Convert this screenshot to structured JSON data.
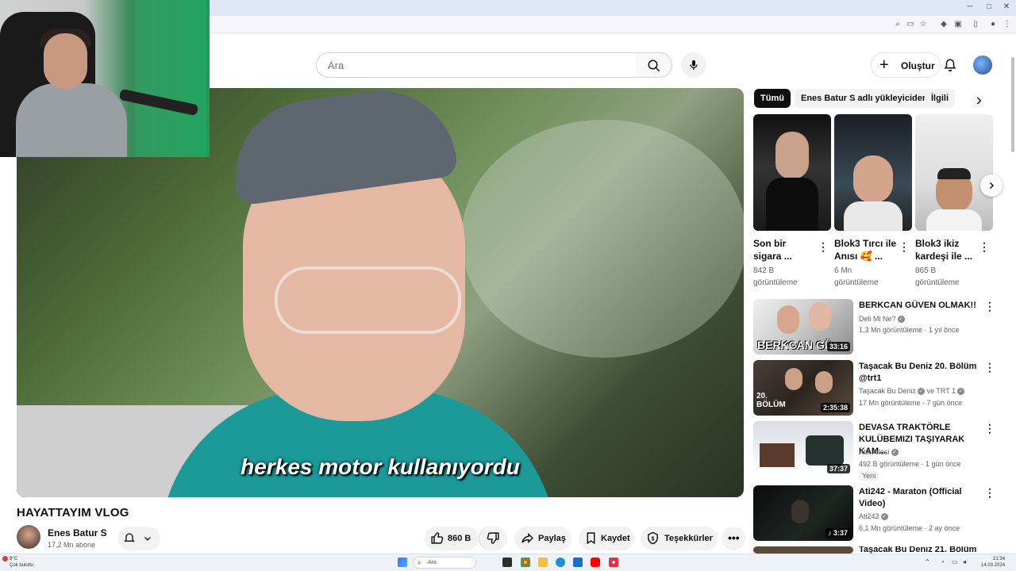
{
  "search": {
    "placeholder": "Ara"
  },
  "header": {
    "create_label": "Oluştur"
  },
  "video": {
    "title": "HAYATTAYIM VLOG",
    "subtitle": "herkes motor kullanıyordu",
    "channel_name": "Enes Batur S",
    "subscribers": "17,2 Mn abone",
    "likes": "860 B",
    "share_label": "Paylaş",
    "save_label": "Kaydet",
    "thanks_label": "Teşekkürler"
  },
  "chips": [
    "Tümü",
    "Enes Batur S adlı yükleyiciden",
    "İlgili"
  ],
  "shorts": [
    {
      "title": "Son bir sigara ...",
      "views": "842 B görüntüleme"
    },
    {
      "title": "Blok3 Tırcı ile Anısı 🥰 ...",
      "views": "6 Mn görüntüleme"
    },
    {
      "title": "Blok3 ikiz kardeşi ile ...",
      "views": "865 B görüntüleme"
    }
  ],
  "related": [
    {
      "title": "BERKCAN GÜVEN OLMAK!!",
      "channel": "Deli Mi Ne?",
      "meta": "1,3 Mn görüntüleme · 1 yıl önce",
      "duration": "33:16",
      "thumb_text": "BERKCAN GÜ"
    },
    {
      "title": "Taşacak Bu Deniz 20. Bölüm @trt1",
      "channel": "Taşacak Bu Deniz",
      "channel2": "ve TRT 1",
      "meta": "17 Mn görüntüleme · 7 gün önce",
      "duration": "2:35:38",
      "thumb_text": "20. BÖLÜM"
    },
    {
      "title": "DEVASA TRAKTÖRLE KULÜBEMIZI TAŞIYARAK KAM...",
      "channel": "Atik Ailesi",
      "meta": "492 B görüntüleme · 1 gün önce",
      "badge": "Yeni",
      "duration": "37:37"
    },
    {
      "title": "Ati242 - Maraton (Official Video)",
      "channel": "Ati242",
      "meta": "6,1 Mn görüntüleme · 2 ay önce",
      "duration": "♪ 3:37"
    },
    {
      "title": "Taşacak Bu Deniz 21. Bölüm"
    }
  ],
  "taskbar": {
    "weather_temp": "8°C",
    "weather_desc": "Çok bulutlu",
    "search_placeholder": "Ara",
    "time": "21:34",
    "date": "14.03.2024"
  },
  "colors": {
    "accent_red": "#ff0000",
    "chip_active": "#0f0f0f",
    "chip_bg": "#f2f2f2"
  }
}
